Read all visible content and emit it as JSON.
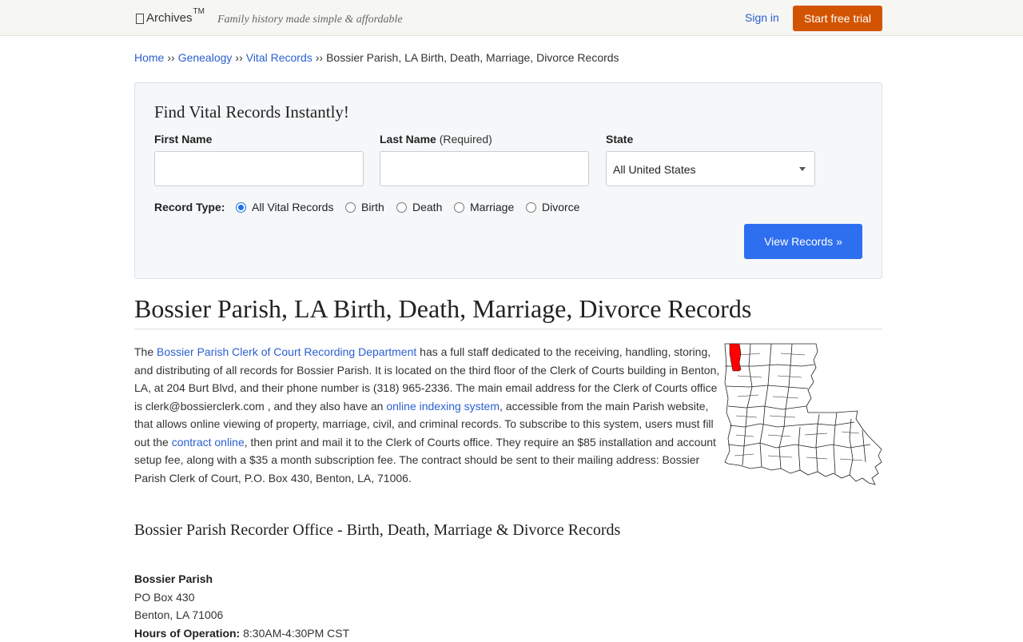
{
  "header": {
    "logo_text": "Archives",
    "logo_tm": "TM",
    "tagline": "Family history made simple & affordable",
    "signin_label": "Sign in",
    "trial_label": "Start free trial"
  },
  "breadcrumb": {
    "items": [
      "Home",
      "Genealogy",
      "Vital Records"
    ],
    "separator": "››",
    "current": "Bossier Parish, LA Birth, Death, Marriage, Divorce Records"
  },
  "search": {
    "title": "Find Vital Records Instantly!",
    "first_name_label": "First Name",
    "last_name_label": "Last Name",
    "last_name_required": "(Required)",
    "state_label": "State",
    "state_value": "All United States",
    "record_type_label": "Record Type:",
    "record_types": [
      "All Vital Records",
      "Birth",
      "Death",
      "Marriage",
      "Divorce"
    ],
    "selected_record_type": "All Vital Records",
    "submit_label": "View Records »"
  },
  "main": {
    "title": "Bossier Parish, LA Birth, Death, Marriage, Divorce Records",
    "para": {
      "t1": "The ",
      "link1": "Bossier Parish Clerk of Court Recording Department",
      "t2": " has a full staff dedicated to the receiving, handling, storing, and distributing of all records for Bossier Parish. It is located on the third floor of the Clerk of Courts building in Benton, LA, at 204 Burt Blvd, and their phone number is (318) 965-2336. The main email address for the Clerk of Courts office is clerk@bossierclerk.com , and they also have an ",
      "link2": "online indexing system",
      "t3": ", accessible from the main Parish website, that allows online viewing of property, marriage, civil, and criminal records. To subscribe to this system, users must fill out the ",
      "link3": "contract online",
      "t4": ", then print and mail it to the Clerk of Courts office. They require an $85 installation and account setup fee, along with a $35 a month subscription fee. The contract should be sent to their mailing address: Bossier Parish Clerk of Court, P.O. Box 430, Benton, LA, 71006."
    },
    "map_highlight_color": "#ff0000",
    "subtitle": "Bossier Parish Recorder Office - Birth, Death, Marriage & Divorce Records",
    "address": {
      "name": "Bossier Parish",
      "line1": "PO Box 430",
      "line2": "Benton, LA 71006",
      "hours_label": "Hours of Operation:",
      "hours_value": "8:30AM-4:30PM CST"
    }
  },
  "colors": {
    "accent": "#d35400",
    "button": "#2e6fef",
    "link": "#2a5fd0"
  }
}
